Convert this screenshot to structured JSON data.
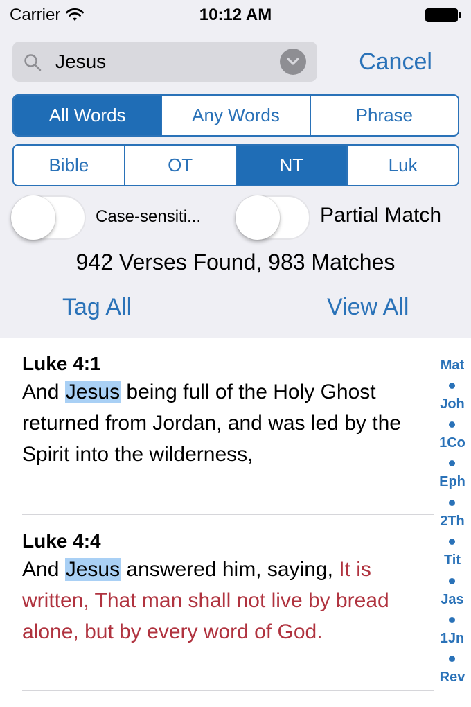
{
  "status_bar": {
    "carrier": "Carrier",
    "time": "10:12 AM"
  },
  "search": {
    "value": "Jesus",
    "placeholder": "",
    "cancel_label": "Cancel"
  },
  "match_mode": {
    "options": [
      "All Words",
      "Any Words",
      "Phrase"
    ],
    "selected": "All Words"
  },
  "scope": {
    "options": [
      "Bible",
      "OT",
      "NT",
      "Luk"
    ],
    "selected": "NT"
  },
  "toggles": {
    "case_sensitive": {
      "label": "Case-sensiti...",
      "on": false
    },
    "partial_match": {
      "label": "Partial Match",
      "on": false
    }
  },
  "summary": "942 Verses Found, 983 Matches",
  "actions": {
    "tag_all": "Tag All",
    "view_all": "View All"
  },
  "results": [
    {
      "ref": "Luke 4:1",
      "pre": "And ",
      "highlight": "Jesus",
      "post": " being full of the Holy Ghost returned from Jordan, and was led by the Spirit into the wilderness,",
      "red": ""
    },
    {
      "ref": "Luke 4:4",
      "pre": "And ",
      "highlight": "Jesus",
      "post": " answered him, saying, ",
      "red": "It is written, That man shall not live by bread alone, but by every word of God."
    }
  ],
  "book_index": [
    "Mat",
    "Joh",
    "1Co",
    "Eph",
    "2Th",
    "Tit",
    "Jas",
    "1Jn",
    "Rev"
  ],
  "colors": {
    "accent": "#2a72b8",
    "highlight": "#a9d0f5",
    "words_of_christ": "#b0333f"
  }
}
